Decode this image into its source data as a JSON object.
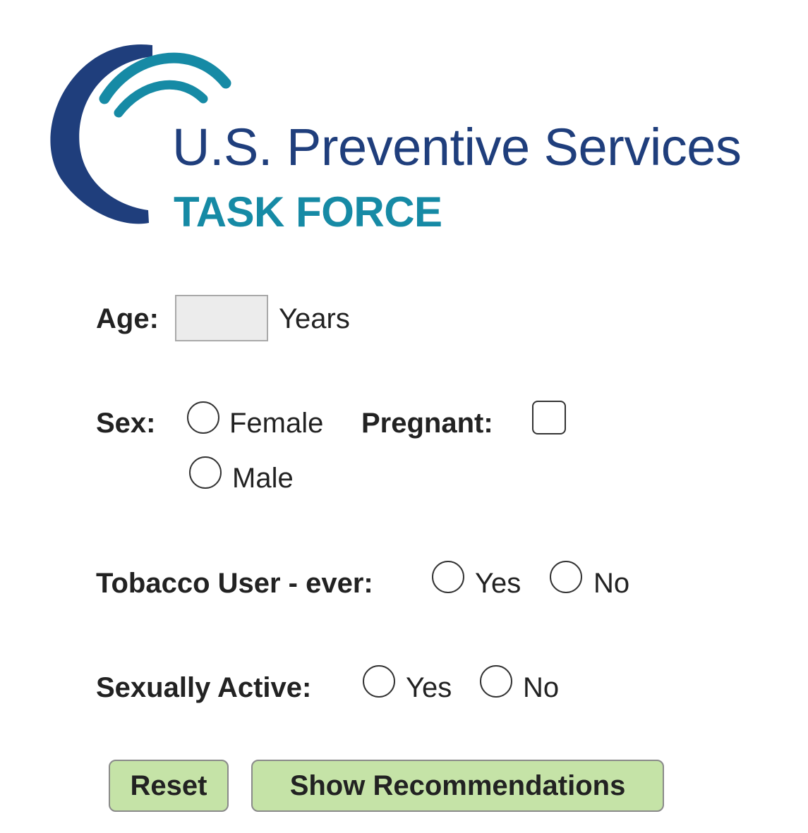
{
  "logo": {
    "title": "U.S. Preventive Services",
    "subtitle": "TASK FORCE",
    "colors": {
      "dark_blue": "#1f3e7c",
      "teal": "#168aa5"
    }
  },
  "form": {
    "age": {
      "label": "Age:",
      "value": "",
      "unit": "Years"
    },
    "sex": {
      "label": "Sex:",
      "options": [
        "Female",
        "Male"
      ],
      "pregnant_label": "Pregnant:"
    },
    "tobacco": {
      "label": "Tobacco User - ever:",
      "options": [
        "Yes",
        "No"
      ]
    },
    "sexually_active": {
      "label": "Sexually Active:",
      "options": [
        "Yes",
        "No"
      ]
    }
  },
  "buttons": {
    "reset": "Reset",
    "show": "Show Recommendations",
    "color": "#c5e3a7"
  }
}
